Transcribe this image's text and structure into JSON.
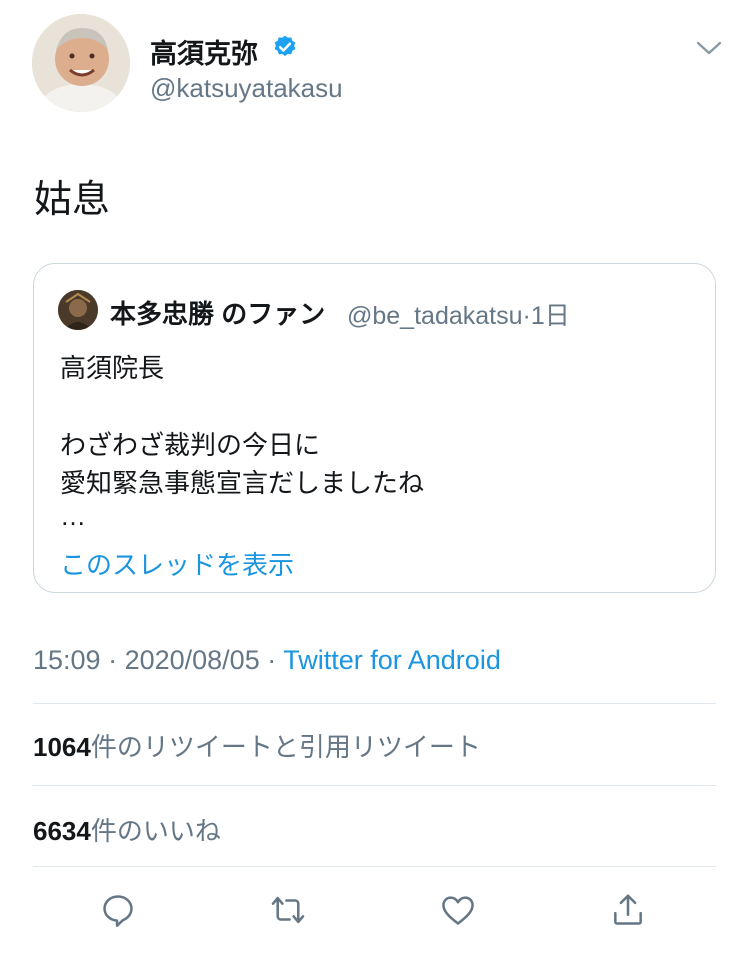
{
  "tweet": {
    "display_name": "高須克弥",
    "handle": "@katsuyatakasu",
    "text": "姑息",
    "time": "15:09",
    "date": "2020/08/05",
    "source": "Twitter for Android"
  },
  "quote": {
    "name": "本多忠勝 のファン",
    "handle": "@be_tadakatsu",
    "age": "1日",
    "lines": [
      "高須院長",
      "わざわざ裁判の今日に",
      "愛知緊急事態宣言だしましたね",
      "…"
    ],
    "thread_link": "このスレッドを表示"
  },
  "stats": {
    "retweets_count": "1064",
    "retweets_label": "件のリツイートと引用リツイート",
    "likes_count": "6634",
    "likes_label": "件のいいね"
  },
  "colors": {
    "link": "#1b95e0",
    "muted": "#657786",
    "text": "#14171a",
    "border": "#e1e8ed"
  },
  "icons": [
    "verified-badge-icon",
    "chevron-down-icon",
    "reply-icon",
    "retweet-icon",
    "like-icon",
    "share-icon"
  ]
}
